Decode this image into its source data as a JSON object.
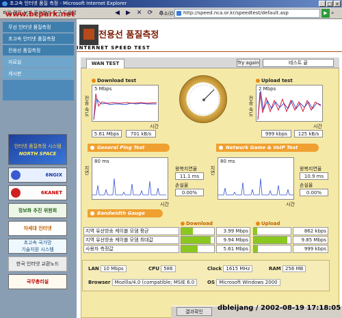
{
  "window": {
    "title": "초고속 인터넷 품질 측정 - Microsoft Internet Explorer",
    "menu": "파일 편집 보기 즐겨찾기 도구 도움말",
    "address_label": "주소(D)",
    "url": "http://speed.nca.or.kr/speedtest/default.asp",
    "go_label": "▶",
    "links_label": "»"
  },
  "watermarks": {
    "top": "www.bcpark.net",
    "bottom": "dbleijang / 2002-08-19 17:18:05"
  },
  "sidebar": {
    "items": [
      {
        "label": "무선 인터넷 품질측정"
      },
      {
        "label": "초고속 인터넷 품질측정"
      },
      {
        "label": "전용선 품질측정"
      },
      {
        "label": "자료실"
      },
      {
        "label": "게시판"
      }
    ],
    "banners": [
      {
        "line1": "인터넷 품질측정 시스템",
        "line2": "NORTH SPACE"
      },
      {
        "label": "6NGIX"
      },
      {
        "label": "6KANET"
      },
      {
        "label": "정보화 추진 위원회"
      },
      {
        "label": "차세대 인터넷"
      },
      {
        "line1": "초고속 국가망",
        "line2": "기술지원 시스템"
      },
      {
        "label": "한국 인터넷 교환노드"
      },
      {
        "label": "국무총리실"
      }
    ]
  },
  "header": {
    "title": "전용선 품질측정",
    "subtitle": "INTERNET SPEED TEST"
  },
  "tabs": {
    "active": "WAN TEST",
    "try_again": "Try again",
    "test_button": "테스트 끝"
  },
  "download": {
    "title": "Download test",
    "scale": "5 Mbps",
    "axis_y": "전송 속도",
    "axis_x": "시간",
    "speed": "5.61 Mbps",
    "bytes": "701 kB/s"
  },
  "upload": {
    "title": "Upload test",
    "scale": "2 Mbps",
    "axis_y": "전송 속도",
    "axis_x": "시간",
    "speed": "999 kbps",
    "bytes": "125 kB/s"
  },
  "ping": {
    "title": "General Ping Test",
    "scale": "80 ms",
    "axis_y": "지연",
    "axis_x": "시간",
    "rtt_label": "왕복지연율",
    "rtt": "11.1 ms",
    "loss_label": "손실율",
    "loss": "0.00%"
  },
  "game": {
    "title": "Network Game & VoIP Test",
    "scale": "80 ms",
    "axis_y": "지연",
    "axis_x": "시간",
    "rtt_label": "왕복지연율",
    "rtt": "10.9 ms",
    "loss_label": "손실율",
    "loss": "0.00%"
  },
  "bandwidth": {
    "title": "Bandwidth Gauge",
    "download_header": "Download",
    "upload_header": "Upload",
    "rows": [
      {
        "label": "지역 유선방송 케이블 모뎀 평균",
        "dl": "3.99 Mbps",
        "dl_fill": 0.35,
        "ul": "862 kbps",
        "ul_fill": 0.1
      },
      {
        "label": "지역 유선방송 케이블 모뎀 최대값",
        "dl": "9.94 Mbps",
        "dl_fill": 0.9,
        "ul": "9.85 Mbps",
        "ul_fill": 0.9
      },
      {
        "label": "사용자 측정값",
        "dl": "5.61 Mbps",
        "dl_fill": 0.5,
        "ul": "999 kbps",
        "ul_fill": 0.12
      }
    ]
  },
  "system": {
    "lan_k": "LAN",
    "lan_v": "10 Mbps",
    "cpu_k": "CPU",
    "cpu_v": "586",
    "clock_k": "Clock",
    "clock_v": "1615 MHz",
    "ram_k": "RAM",
    "ram_v": "256 MB",
    "browser_k": "Browser",
    "browser_v": "Mozilla/4.0 (compatible; MSIE 6.0",
    "os_k": "OS",
    "os_v": "Microsoft Windows 2000"
  },
  "status": {
    "result_button": "결과확인"
  }
}
